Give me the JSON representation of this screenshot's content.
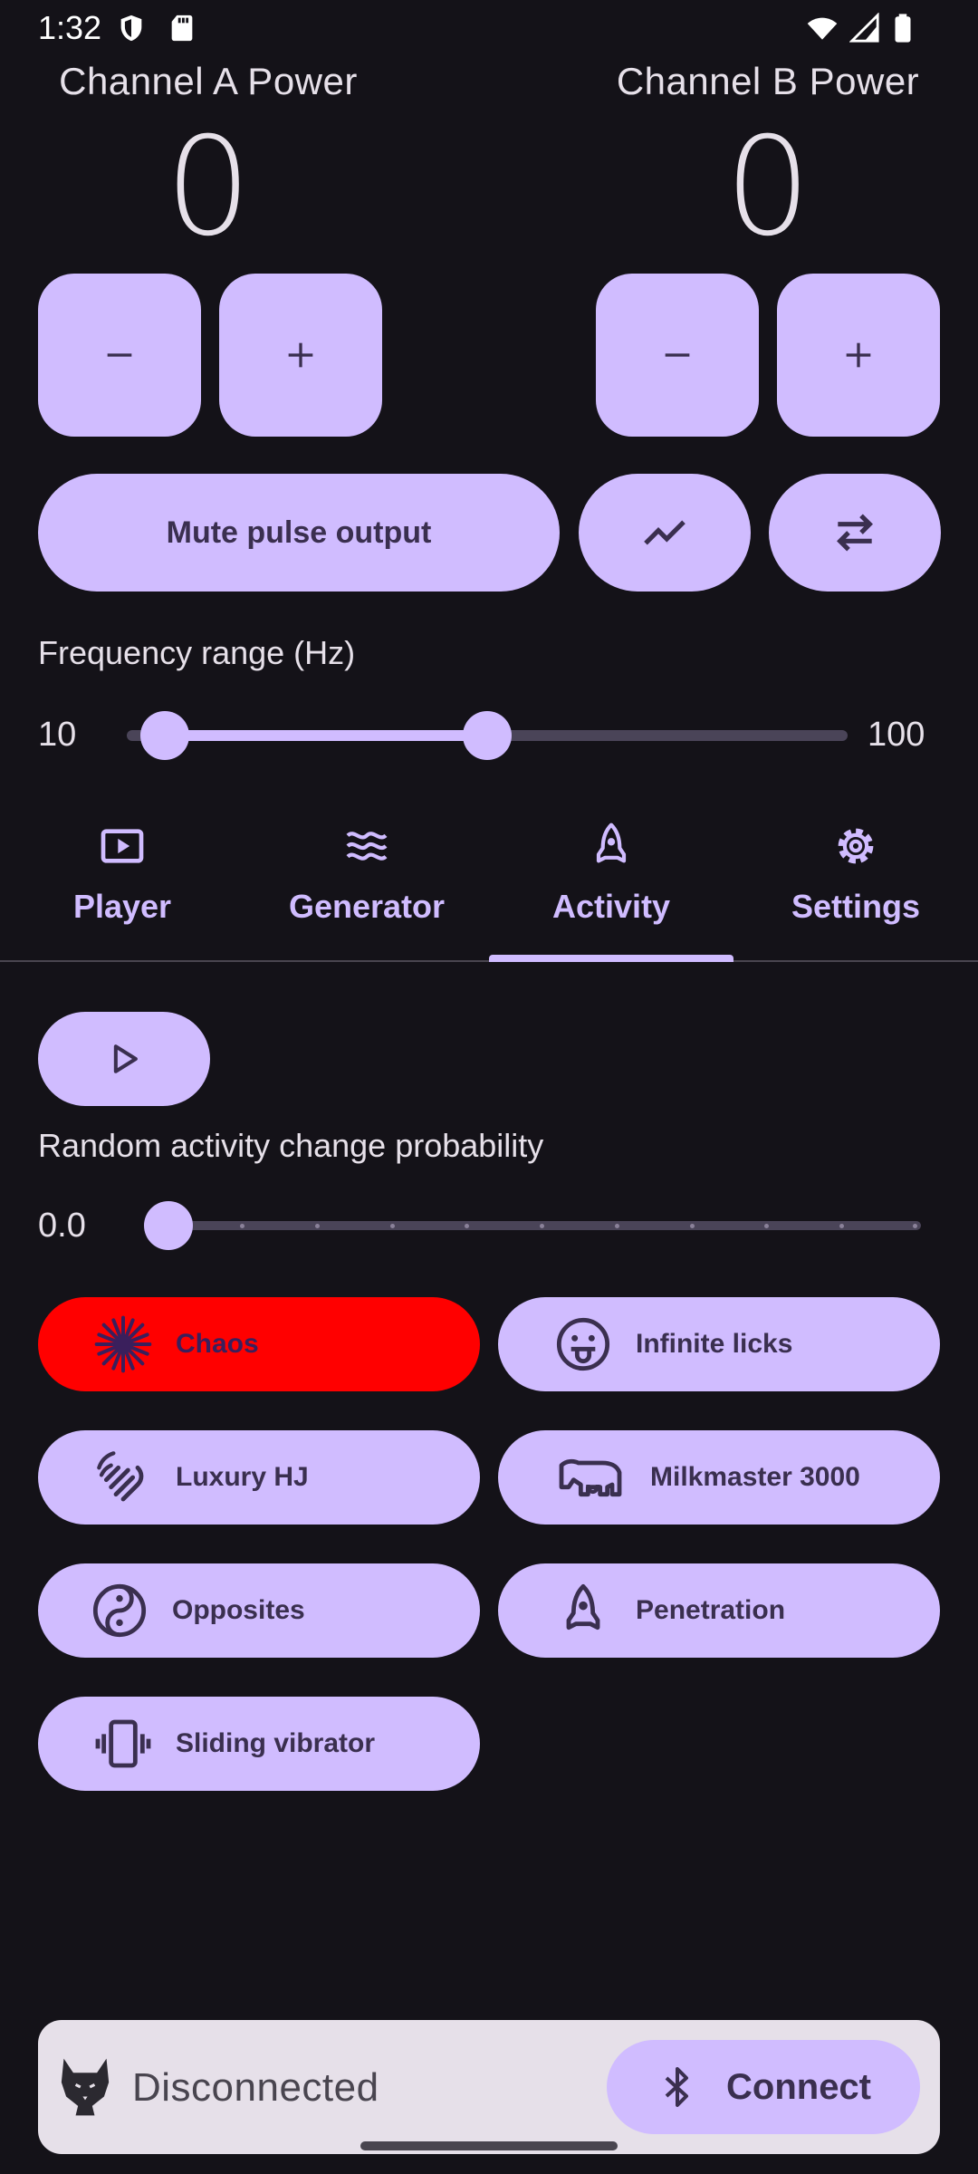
{
  "status_bar": {
    "time": "1:32"
  },
  "channels": [
    {
      "label": "Channel A Power",
      "value": "0",
      "decrease_label": "−",
      "increase_label": "+"
    },
    {
      "label": "Channel B Power",
      "value": "0",
      "decrease_label": "−",
      "increase_label": "+"
    }
  ],
  "controls": {
    "mute_label": "Mute pulse output"
  },
  "frequency": {
    "title": "Frequency range (Hz)",
    "min_label": "10",
    "max_label": "100"
  },
  "tabs": [
    {
      "label": "Player",
      "icon": "play-box-icon"
    },
    {
      "label": "Generator",
      "icon": "waves-icon"
    },
    {
      "label": "Activity",
      "icon": "rocket-icon",
      "selected": true
    },
    {
      "label": "Settings",
      "icon": "gear-icon"
    }
  ],
  "activity": {
    "probability_title": "Random activity change probability",
    "probability_value": "0.0",
    "items": [
      {
        "label": "Chaos",
        "icon": "chaos-icon",
        "active": true
      },
      {
        "label": "Infinite licks",
        "icon": "tongue-face-icon"
      },
      {
        "label": "Luxury HJ",
        "icon": "hand-icon"
      },
      {
        "label": "Milkmaster 3000",
        "icon": "cow-icon"
      },
      {
        "label": "Opposites",
        "icon": "yin-yang-icon"
      },
      {
        "label": "Penetration",
        "icon": "rocket-icon"
      },
      {
        "label": "Sliding vibrator",
        "icon": "vibrate-icon"
      }
    ]
  },
  "connection": {
    "status": "Disconnected",
    "connect_label": "Connect"
  },
  "colors": {
    "background": "#141218",
    "primary": "#d0bcff",
    "active": "#ff0000"
  }
}
